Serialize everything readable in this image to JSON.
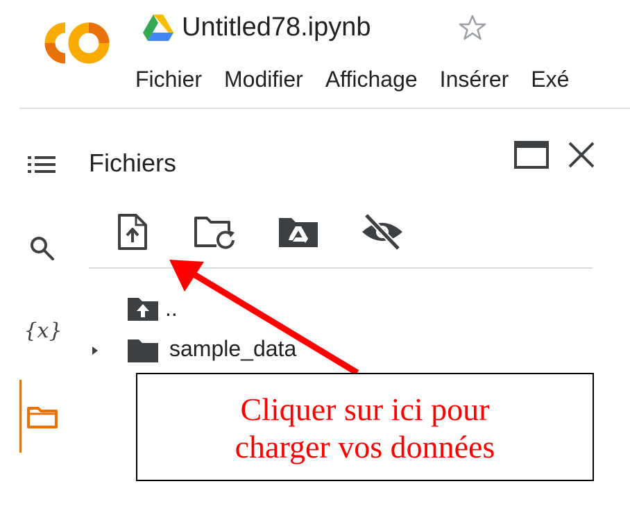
{
  "header": {
    "logo_text": "CO",
    "document_title": "Untitled78.ipynb"
  },
  "menu": {
    "items": [
      {
        "label": "Fichier"
      },
      {
        "label": "Modifier"
      },
      {
        "label": "Affichage"
      },
      {
        "label": "Insérer"
      },
      {
        "label": "Exé"
      }
    ]
  },
  "sidebar_rail": {
    "icons": [
      "toc-icon",
      "search-icon",
      "variables-icon",
      "folder-icon"
    ],
    "variables_label": "{x}",
    "active": "files"
  },
  "files_panel": {
    "title": "Fichiers",
    "toolbar": [
      "upload-icon",
      "folder-refresh-icon",
      "drive-mount-icon",
      "eye-off-icon"
    ],
    "tree": [
      {
        "label": "..",
        "type": "parent-folder"
      },
      {
        "label": "sample_data",
        "type": "folder",
        "expandable": true
      }
    ]
  },
  "annotation": {
    "line1": "Cliquer sur ici pour",
    "line2": "charger vos données"
  },
  "colors": {
    "colab_orange": "#f9ab00",
    "colab_dark_orange": "#e8710a",
    "icon_gray": "#5f6368",
    "annotation_red": "#ff0000"
  }
}
